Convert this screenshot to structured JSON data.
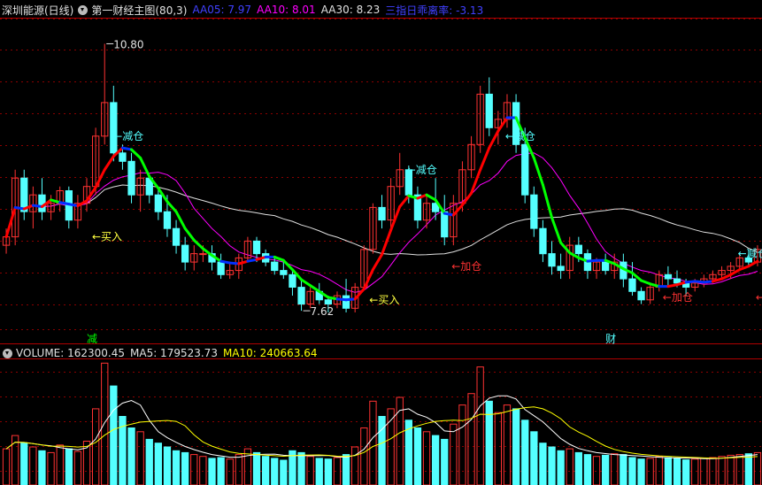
{
  "main_header": {
    "symbol": "深圳能源(日线)",
    "indicator": "第一财经主图(80,3)",
    "aa05_label": "AA05: 7.97",
    "aa10_label": "AA10: 8.01",
    "aa30_label": "AA30: 8.23",
    "ratio_label": "三指日乖离率: -3.13"
  },
  "volume_header": {
    "volume_label": "VOLUME: 162300.45",
    "ma5_label": "MA5: 179523.73",
    "ma10_label": "MA10: 240663.64"
  },
  "annotations": {
    "high_price": "10.80",
    "low_price": "7.62",
    "reduce": "←减仓",
    "buy": "←买入",
    "add": "←加仓",
    "marker_reduce": "减",
    "marker_wealth": "财"
  },
  "colors": {
    "up": "#ff3232",
    "down": "#54ffff",
    "aa05": "#4040ff",
    "aa10": "#ff00ff",
    "aa30": "#e0e0e0",
    "ratio": "#4040ff",
    "vol_ma5": "#ffffff",
    "vol_ma10": "#ffff00",
    "grid": "#8b0000",
    "trend_up": "#ff0000",
    "trend_down": "#00ff00",
    "trend_flat": "#0030ff",
    "trend_mid": "#00ffff",
    "bg": "#000000"
  },
  "chart_data": {
    "type": "candlestick",
    "price_range": [
      7.4,
      11.1
    ],
    "volume_range": [
      0,
      330000
    ],
    "candles": [
      [
        8.4,
        8.6,
        8.3,
        8.5
      ],
      [
        8.5,
        9.3,
        8.4,
        9.2
      ],
      [
        9.2,
        9.3,
        8.7,
        8.8
      ],
      [
        8.8,
        9.1,
        8.6,
        9.0
      ],
      [
        9.0,
        9.2,
        8.7,
        8.8
      ],
      [
        8.8,
        9.0,
        8.7,
        8.9
      ],
      [
        8.9,
        9.1,
        8.8,
        9.05
      ],
      [
        9.05,
        9.1,
        8.6,
        8.7
      ],
      [
        8.7,
        9.0,
        8.6,
        8.9
      ],
      [
        8.9,
        9.2,
        8.8,
        9.1
      ],
      [
        9.1,
        9.8,
        9.0,
        9.7
      ],
      [
        9.7,
        10.8,
        9.6,
        10.1
      ],
      [
        10.1,
        10.3,
        9.4,
        9.5
      ],
      [
        9.5,
        9.6,
        9.3,
        9.4
      ],
      [
        9.4,
        9.5,
        8.9,
        9.0
      ],
      [
        9.0,
        9.3,
        8.8,
        9.2
      ],
      [
        9.2,
        9.25,
        8.9,
        9.0
      ],
      [
        9.0,
        9.1,
        8.7,
        8.8
      ],
      [
        8.8,
        9.0,
        8.5,
        8.6
      ],
      [
        8.6,
        8.7,
        8.3,
        8.4
      ],
      [
        8.4,
        8.5,
        8.1,
        8.2
      ],
      [
        8.2,
        8.4,
        8.1,
        8.3
      ],
      [
        8.3,
        8.4,
        8.2,
        8.3
      ],
      [
        8.3,
        8.4,
        8.1,
        8.2
      ],
      [
        8.2,
        8.3,
        8.0,
        8.05
      ],
      [
        8.05,
        8.2,
        8.0,
        8.1
      ],
      [
        8.1,
        8.3,
        8.0,
        8.25
      ],
      [
        8.25,
        8.5,
        8.2,
        8.45
      ],
      [
        8.45,
        8.5,
        8.2,
        8.3
      ],
      [
        8.3,
        8.35,
        8.15,
        8.2
      ],
      [
        8.2,
        8.25,
        8.05,
        8.1
      ],
      [
        8.1,
        8.2,
        8.0,
        8.05
      ],
      [
        8.05,
        8.1,
        7.8,
        7.9
      ],
      [
        7.9,
        8.0,
        7.62,
        7.7
      ],
      [
        7.7,
        7.9,
        7.65,
        7.85
      ],
      [
        7.85,
        7.95,
        7.7,
        7.75
      ],
      [
        7.75,
        7.8,
        7.6,
        7.7
      ],
      [
        7.7,
        7.85,
        7.65,
        7.8
      ],
      [
        7.8,
        8.0,
        7.6,
        7.65
      ],
      [
        7.65,
        7.95,
        7.6,
        7.9
      ],
      [
        7.9,
        8.4,
        7.9,
        8.35
      ],
      [
        8.35,
        8.9,
        8.3,
        8.85
      ],
      [
        8.85,
        9.0,
        8.6,
        8.7
      ],
      [
        8.7,
        9.2,
        8.6,
        9.1
      ],
      [
        9.1,
        9.5,
        9.0,
        9.3
      ],
      [
        9.3,
        9.35,
        8.9,
        9.0
      ],
      [
        9.0,
        9.1,
        8.6,
        8.7
      ],
      [
        8.7,
        9.0,
        8.6,
        8.9
      ],
      [
        8.9,
        9.2,
        8.7,
        8.8
      ],
      [
        8.8,
        9.0,
        8.4,
        8.5
      ],
      [
        8.5,
        9.0,
        8.4,
        8.9
      ],
      [
        8.9,
        9.4,
        8.8,
        9.3
      ],
      [
        9.3,
        9.7,
        9.2,
        9.6
      ],
      [
        9.6,
        10.3,
        9.5,
        10.2
      ],
      [
        10.2,
        10.4,
        9.7,
        9.8
      ],
      [
        9.8,
        10.0,
        9.6,
        9.9
      ],
      [
        9.9,
        10.2,
        9.8,
        10.1
      ],
      [
        10.1,
        10.2,
        9.5,
        9.6
      ],
      [
        9.6,
        9.8,
        8.9,
        9.0
      ],
      [
        9.0,
        9.1,
        8.5,
        8.6
      ],
      [
        8.6,
        8.7,
        8.2,
        8.3
      ],
      [
        8.3,
        8.45,
        8.05,
        8.15
      ],
      [
        8.15,
        8.3,
        8.0,
        8.1
      ],
      [
        8.1,
        8.5,
        8.0,
        8.4
      ],
      [
        8.4,
        8.5,
        8.2,
        8.3
      ],
      [
        8.3,
        8.35,
        8.0,
        8.1
      ],
      [
        8.1,
        8.25,
        8.0,
        8.2
      ],
      [
        8.2,
        8.3,
        8.05,
        8.1
      ],
      [
        8.1,
        8.3,
        8.0,
        8.2
      ],
      [
        8.2,
        8.3,
        7.9,
        8.0
      ],
      [
        8.0,
        8.2,
        7.8,
        7.85
      ],
      [
        7.85,
        7.9,
        7.7,
        7.75
      ],
      [
        7.75,
        7.95,
        7.7,
        7.9
      ],
      [
        7.9,
        8.1,
        7.85,
        8.05
      ],
      [
        8.05,
        8.15,
        7.9,
        8.0
      ],
      [
        8.0,
        8.1,
        7.9,
        7.95
      ],
      [
        7.95,
        8.0,
        7.8,
        7.9
      ],
      [
        7.9,
        8.0,
        7.85,
        7.95
      ],
      [
        7.95,
        8.05,
        7.9,
        8.0
      ],
      [
        8.0,
        8.1,
        7.95,
        8.05
      ],
      [
        8.05,
        8.15,
        8.0,
        8.1
      ],
      [
        8.1,
        8.2,
        8.0,
        8.15
      ],
      [
        8.15,
        8.3,
        8.1,
        8.25
      ],
      [
        8.25,
        8.35,
        8.15,
        8.2
      ],
      [
        8.2,
        8.4,
        8.15,
        8.35
      ]
    ],
    "volumes": [
      95000,
      130000,
      110000,
      100000,
      90000,
      85000,
      105000,
      95000,
      88000,
      115000,
      200000,
      320000,
      260000,
      180000,
      150000,
      140000,
      120000,
      110000,
      100000,
      90000,
      85000,
      80000,
      75000,
      70000,
      72000,
      68000,
      80000,
      95000,
      85000,
      75000,
      70000,
      65000,
      90000,
      85000,
      75000,
      70000,
      68000,
      72000,
      80000,
      100000,
      150000,
      220000,
      180000,
      200000,
      230000,
      170000,
      150000,
      140000,
      130000,
      120000,
      160000,
      210000,
      240000,
      310000,
      220000,
      190000,
      210000,
      200000,
      170000,
      140000,
      110000,
      100000,
      90000,
      95000,
      85000,
      80000,
      75000,
      78000,
      82000,
      80000,
      72000,
      68000,
      70000,
      75000,
      72000,
      70000,
      66000,
      68000,
      70000,
      72000,
      75000,
      78000,
      80000,
      82000,
      85000
    ],
    "ma_periods": {
      "aa05": 5,
      "aa10": 10,
      "aa30": 30
    }
  }
}
